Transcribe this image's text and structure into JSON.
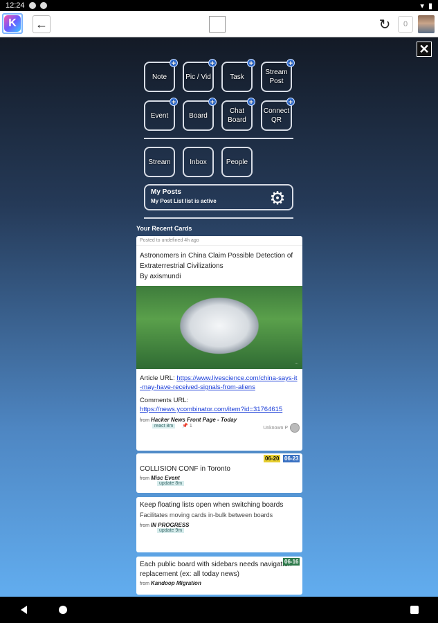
{
  "status": {
    "time": "12:24"
  },
  "header": {
    "center_logo_text": "",
    "count": "0"
  },
  "quick": {
    "row1": [
      "Note",
      "Pic / Vid",
      "Task",
      "Stream Post"
    ],
    "row2": [
      "Event",
      "Board",
      "Chat Board",
      "Connect QR"
    ],
    "row3": [
      "Stream",
      "Inbox",
      "People"
    ]
  },
  "myposts": {
    "title": "My Posts",
    "subtitle": "My Post List list is active"
  },
  "recent_title": "Your Recent Cards",
  "cards": [
    {
      "meta": "Posted to undefined 4h ago",
      "title": "Astronomers in China Claim Possible Detection of Extraterrestrial Civilizations",
      "by": "By axismundi",
      "article_label": "Article URL: ",
      "article_url": "https://www.livescience.com/china-says-it-may-have-received-signals-from-aliens",
      "comments_label": "Comments URL:",
      "comments_url": "https://news.ycombinator.com/item?id=31764615",
      "from_label": "from",
      "source": "Hacker News Front Page - Today",
      "unknown": "Unknown P",
      "tag": "react 8m",
      "pin_count": "1"
    },
    {
      "title": "COLLISION CONF in Toronto",
      "from_label": "from",
      "source": "Misc Event",
      "tag": "update 8m",
      "badge1": "06-20",
      "badge2": "06-23"
    },
    {
      "title": "Keep floating lists open when switching boards",
      "desc": "Facilitates moving cards in-bulk between boards",
      "from_label": "from",
      "source": "IN PROGRESS",
      "tag": "update 9m"
    },
    {
      "title": "Each public board with sidebars needs navigation replacement (ex: all today news)",
      "from_label": "from",
      "source": "Kandoop Migration",
      "badge": "06-16"
    }
  ],
  "colors": {
    "accent": "#2f6fd8",
    "badge_yellow": "#e6ce2e",
    "badge_blue": "#3a71c2",
    "badge_green": "#2e7a4a"
  }
}
